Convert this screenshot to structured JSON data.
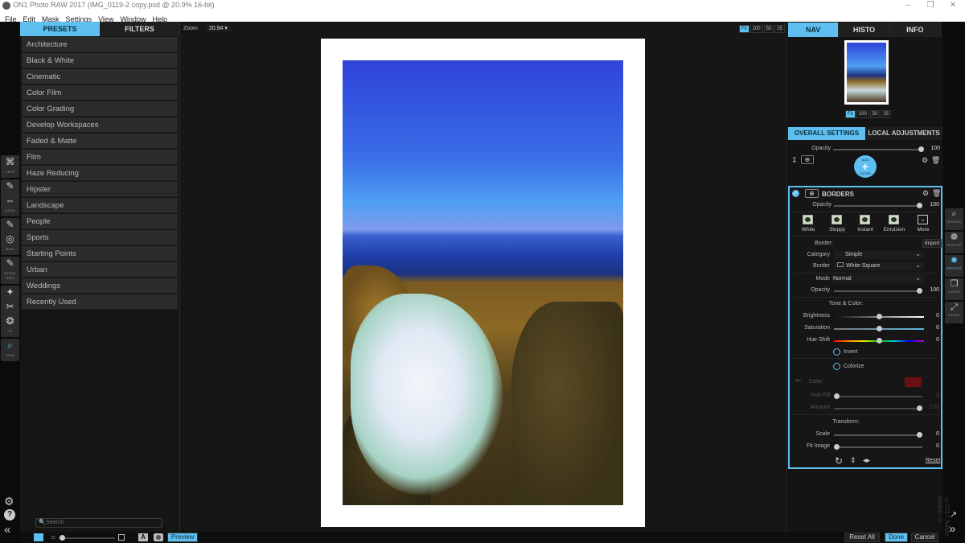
{
  "window": {
    "title": "ON1 Photo RAW 2017 (IMG_0119-2 copy.psd @ 20.9% 16-bit)",
    "controls": [
      "minimize-icon",
      "maximize-icon",
      "close-icon"
    ],
    "controls_glyphs": [
      "–",
      "❐",
      "✕"
    ]
  },
  "menu": [
    "File",
    "Edit",
    "Mask",
    "Settings",
    "View",
    "Window",
    "Help"
  ],
  "tools": [
    {
      "icon": "crop-icon",
      "glyph": "⌘",
      "label": "CROP"
    },
    {
      "icon": "brush-icon",
      "glyph": "✎",
      "label": ""
    },
    {
      "icon": "local-icon",
      "glyph": "⇔",
      "label": "LOCAL"
    },
    {
      "icon": "masking-brush-icon",
      "glyph": "✎",
      "label": ""
    },
    {
      "icon": "mask-icon",
      "glyph": "◎",
      "label": "MASK"
    },
    {
      "icon": "refine-brush-icon",
      "glyph": "✎",
      "label": "REFINE MASK"
    },
    {
      "icon": "retouch-icon",
      "glyph": "✦",
      "label": ""
    },
    {
      "icon": "bandaid-icon",
      "glyph": "✂",
      "label": ""
    },
    {
      "icon": "stamp-icon",
      "glyph": "❂",
      "label": "FIX"
    },
    {
      "icon": "view-zoom-icon",
      "glyph": "⌕",
      "label": "VIEW"
    }
  ],
  "presets_panel": {
    "tabs": [
      "PRESETS",
      "FILTERS"
    ],
    "active_tab": 0,
    "categories": [
      "Architecture",
      "Black & White",
      "Cinematic",
      "Color Film",
      "Color Grading",
      "Develop Workspaces",
      "Faded & Matte",
      "Film",
      "Haze Reducing",
      "Hipster",
      "Landscape",
      "People",
      "Sports",
      "Starting Points",
      "Urban",
      "Weddings",
      "Recently Used"
    ],
    "search_placeholder": "Search"
  },
  "canvas": {
    "zoom_label": "Zoom",
    "zoom_value": "20.94",
    "zoom_buttons": [
      "Fit",
      "100",
      "50",
      "25"
    ],
    "active_zoom": "Fit"
  },
  "right_panel": {
    "tabs": [
      "NAV",
      "HISTO",
      "INFO"
    ],
    "active_tab": "NAV",
    "nav_zoom_buttons": [
      "Fit",
      "100",
      "50",
      "25"
    ],
    "settings_tabs": [
      "OVERALL SETTINGS",
      "LOCAL ADJUSTMENTS"
    ],
    "overall_opacity_label": "Opacity",
    "overall_opacity_value": "100",
    "add_filter_top": "ADD",
    "add_filter_bottom": "FILTER",
    "filter": {
      "name": "BORDERS",
      "opacity_label": "Opacity",
      "opacity_value": "100",
      "presets": [
        "White",
        "Sloppy",
        "Instant",
        "Emulsion",
        "More"
      ],
      "border_section": "Border:",
      "import_label": "Import",
      "category_label": "Category",
      "category_value": "Simple",
      "border_label": "Border",
      "border_value": "White Square",
      "mode_label": "Mode",
      "mode_value": "Normal",
      "mode_opacity_label": "Opacity",
      "mode_opacity_value": "100",
      "tone_section": "Tone & Color:",
      "brightness_label": "Brightness",
      "brightness_value": "0",
      "saturation_label": "Saturation",
      "saturation_value": "0",
      "hue_shift_label": "Hue Shift",
      "hue_shift_value": "0",
      "invert_label": "Invert",
      "colorize_label": "Colorize",
      "color_label": "Color:",
      "color_swatch": "#6b1010",
      "hue_fill_label": "Hue Fill",
      "hue_fill_value": "0",
      "amount_label": "Amount",
      "amount_value": "100",
      "transform_section": "Transform:",
      "scale_label": "Scale",
      "scale_value": "0",
      "fit_image_label": "Fit Image",
      "fit_image_value": "0",
      "reset_label": "Reset",
      "slider_positions": {
        "opacity": 1.0,
        "mode_opacity": 1.0,
        "brightness": 0.5,
        "saturation": 0.5,
        "hue_shift": 0.5,
        "hue_fill": 0.0,
        "amount": 1.0,
        "scale": 1.0,
        "fit_image": 0.0
      }
    }
  },
  "modules": [
    {
      "icon": "browse-icon",
      "glyph": "⌕",
      "label": "BROWSE"
    },
    {
      "icon": "develop-icon",
      "glyph": "❁",
      "label": "DEVELOP"
    },
    {
      "icon": "effects-icon",
      "glyph": "✹",
      "label": "EFFECTS",
      "active": true
    },
    {
      "icon": "layers-icon",
      "glyph": "❐",
      "label": "LAYERS"
    },
    {
      "icon": "resize-icon",
      "glyph": "⤢",
      "label": "RESIZE"
    }
  ],
  "watermark": "©2017 Adam Welch ©",
  "bottom": {
    "preview_label": "Preview",
    "reset_all_label": "Reset All",
    "done_label": "Done",
    "cancel_label": "Cancel"
  },
  "accent_color": "#5ebff0"
}
